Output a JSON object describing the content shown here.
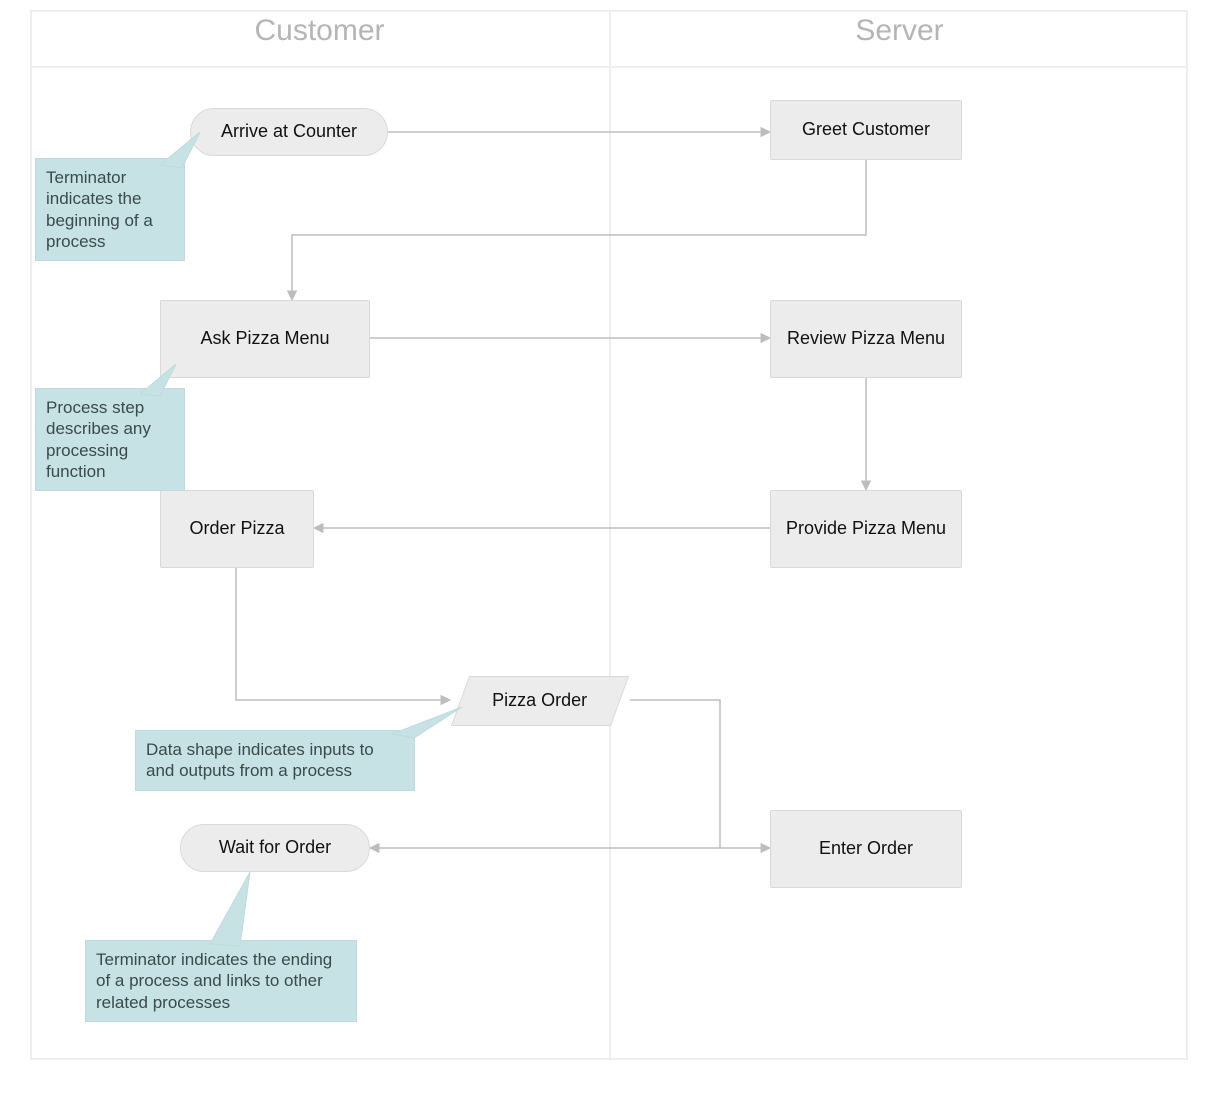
{
  "lanes": {
    "customer": "Customer",
    "server": "Server"
  },
  "nodes": {
    "arrive_at_counter": "Arrive at Counter",
    "greet_customer": "Greet Customer",
    "ask_pizza_menu": "Ask Pizza Menu",
    "review_pizza_menu": "Review Pizza Menu",
    "provide_pizza_menu": "Provide Pizza Menu",
    "order_pizza": "Order Pizza",
    "pizza_order": "Pizza Order",
    "enter_order": "Enter Order",
    "wait_for_order": "Wait for Order"
  },
  "callouts": {
    "terminator_start": "Terminator indicates the beginning of a process",
    "process_step": "Process step describes any processing function",
    "data_shape": "Data shape indicates inputs to and outputs from a process",
    "terminator_end": "Terminator  indicates the ending of a process and links to other related processes"
  },
  "edges": [
    {
      "from": "arrive_at_counter",
      "to": "greet_customer"
    },
    {
      "from": "greet_customer",
      "to": "ask_pizza_menu"
    },
    {
      "from": "ask_pizza_menu",
      "to": "review_pizza_menu"
    },
    {
      "from": "review_pizza_menu",
      "to": "provide_pizza_menu"
    },
    {
      "from": "provide_pizza_menu",
      "to": "order_pizza"
    },
    {
      "from": "order_pizza",
      "to": "pizza_order"
    },
    {
      "from": "pizza_order",
      "to": "enter_order"
    },
    {
      "from": "pizza_order",
      "to": "wait_for_order"
    }
  ]
}
